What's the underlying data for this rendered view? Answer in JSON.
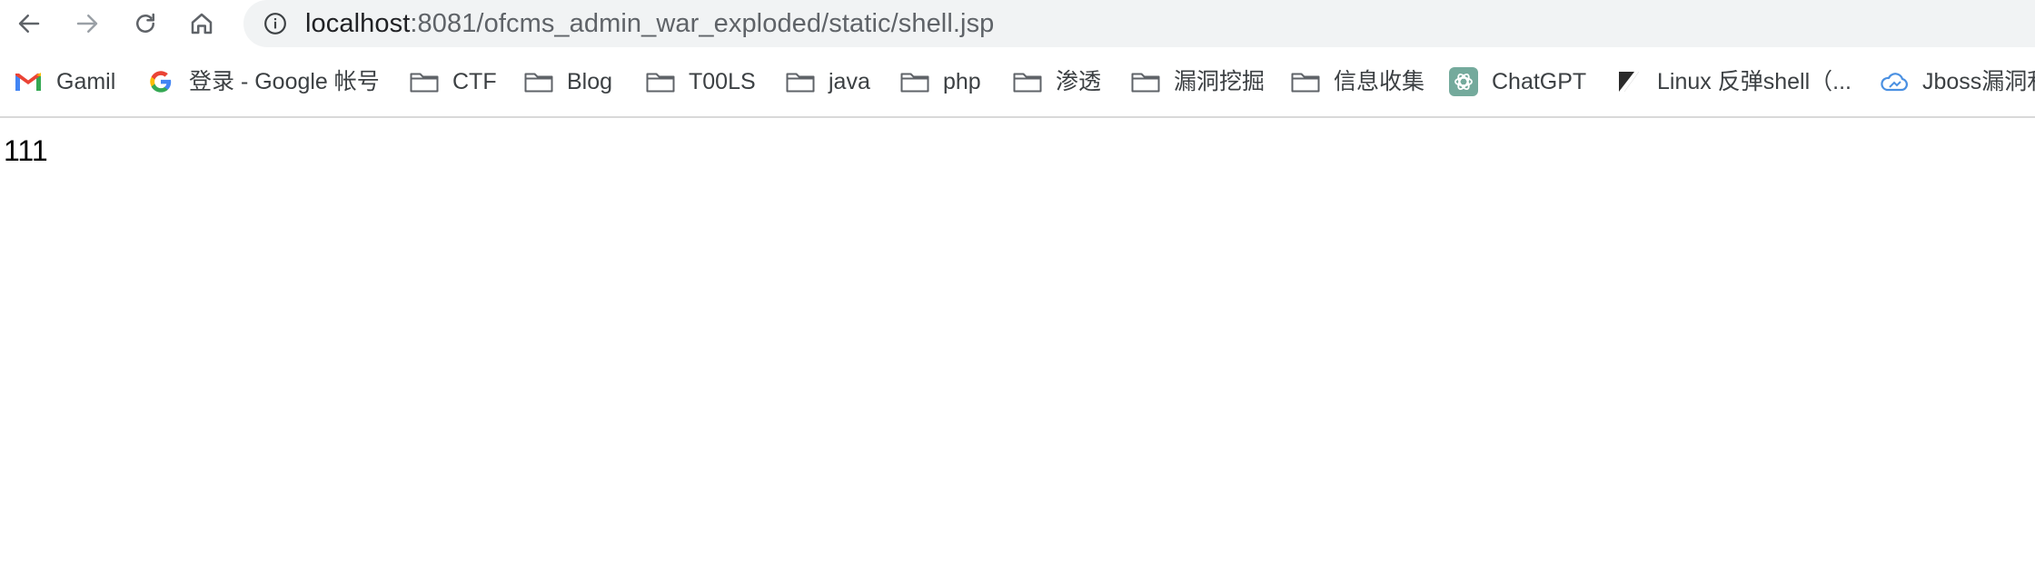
{
  "browser": {
    "url_host": "localhost",
    "url_rest": ":8081/ofcms_admin_war_exploded/static/shell.jsp",
    "colors": {
      "toolbar_icon": "#5f6368",
      "disabled_icon": "#9aa0a6",
      "omnibox_bg": "#f1f3f4"
    }
  },
  "bookmarks": [
    {
      "label": "Gamil",
      "icon": "gmail-icon"
    },
    {
      "label": "登录 - Google 帐号",
      "icon": "google-icon"
    },
    {
      "label": "CTF",
      "icon": "folder-icon"
    },
    {
      "label": "Blog",
      "icon": "folder-icon"
    },
    {
      "label": "T00LS",
      "icon": "folder-icon"
    },
    {
      "label": "java",
      "icon": "folder-icon"
    },
    {
      "label": "php",
      "icon": "folder-icon"
    },
    {
      "label": "渗透",
      "icon": "folder-icon"
    },
    {
      "label": "漏洞挖掘",
      "icon": "folder-icon"
    },
    {
      "label": "信息收集",
      "icon": "folder-icon"
    },
    {
      "label": "ChatGPT",
      "icon": "chatgpt-icon"
    },
    {
      "label": "Linux 反弹shell（...",
      "icon": "slash-icon"
    },
    {
      "label": "Jboss漏洞利",
      "icon": "cloud-icon"
    }
  ],
  "page": {
    "body_text": "111"
  }
}
